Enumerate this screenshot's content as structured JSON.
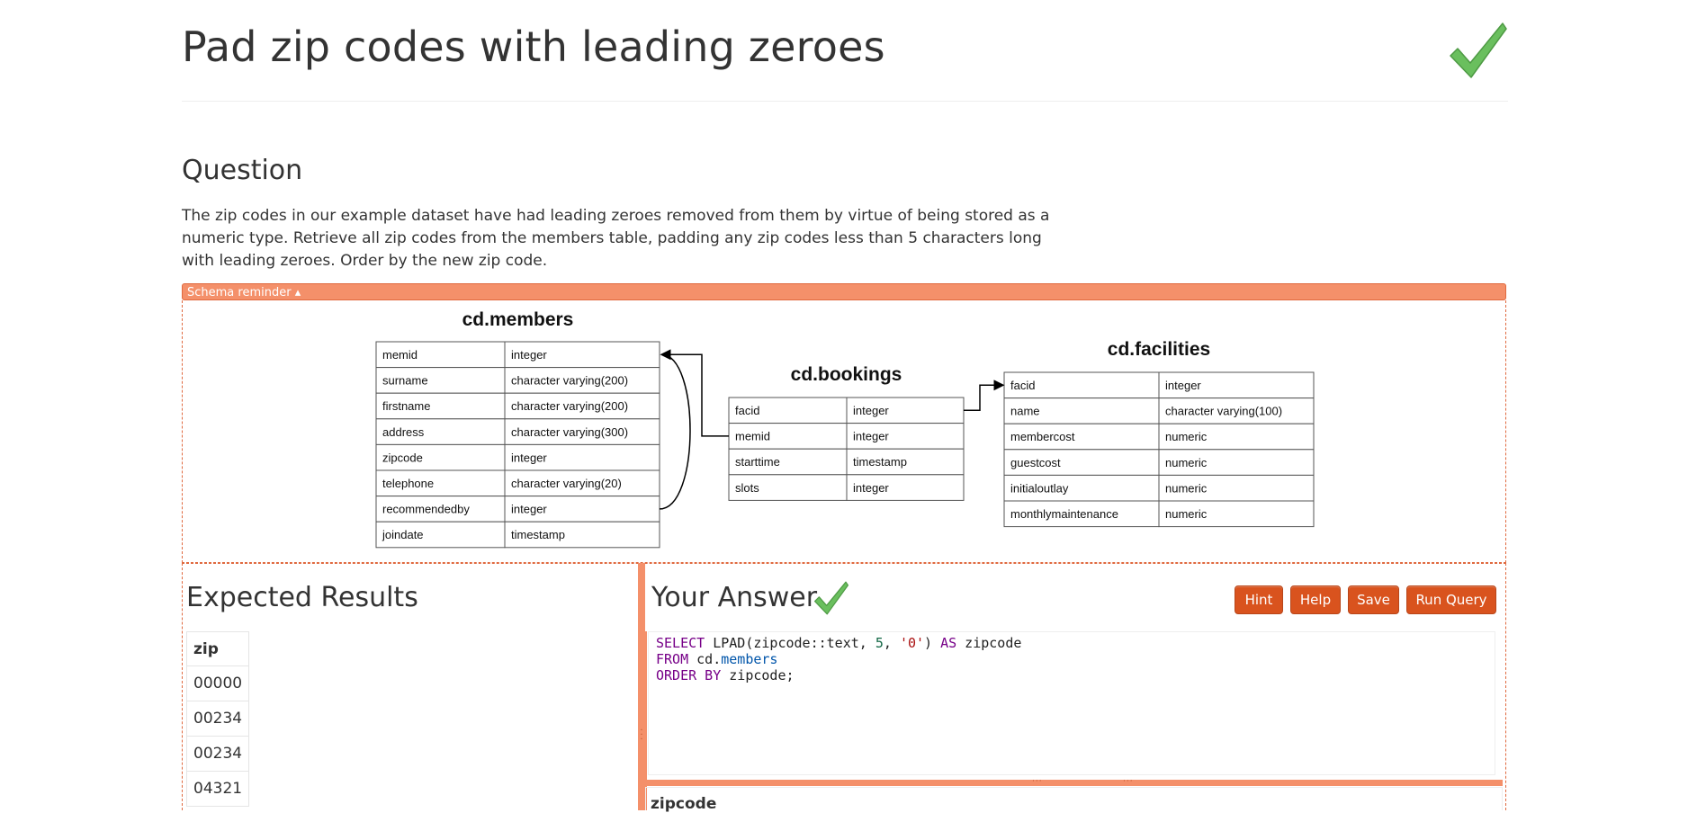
{
  "page": {
    "title": "Pad zip codes with leading zeroes"
  },
  "question": {
    "heading": "Question",
    "text": "The zip codes in our example dataset have had leading zeroes removed from them by virtue of being stored as a numeric type. Retrieve all zip codes from the members table, padding any zip codes less than 5 characters long with leading zeroes. Order by the new zip code."
  },
  "schema": {
    "toggle_label": "Schema reminder ▴",
    "tables": [
      {
        "name": "cd.members",
        "columns": [
          {
            "col": "memid",
            "type": "integer"
          },
          {
            "col": "surname",
            "type": "character varying(200)"
          },
          {
            "col": "firstname",
            "type": "character varying(200)"
          },
          {
            "col": "address",
            "type": "character varying(300)"
          },
          {
            "col": "zipcode",
            "type": "integer"
          },
          {
            "col": "telephone",
            "type": "character varying(20)"
          },
          {
            "col": "recommendedby",
            "type": "integer"
          },
          {
            "col": "joindate",
            "type": "timestamp"
          }
        ]
      },
      {
        "name": "cd.bookings",
        "columns": [
          {
            "col": "facid",
            "type": "integer"
          },
          {
            "col": "memid",
            "type": "integer"
          },
          {
            "col": "starttime",
            "type": "timestamp"
          },
          {
            "col": "slots",
            "type": "integer"
          }
        ]
      },
      {
        "name": "cd.facilities",
        "columns": [
          {
            "col": "facid",
            "type": "integer"
          },
          {
            "col": "name",
            "type": "character varying(100)"
          },
          {
            "col": "membercost",
            "type": "numeric"
          },
          {
            "col": "guestcost",
            "type": "numeric"
          },
          {
            "col": "initialoutlay",
            "type": "numeric"
          },
          {
            "col": "monthlymaintenance",
            "type": "numeric"
          }
        ]
      }
    ]
  },
  "expected": {
    "heading": "Expected Results",
    "column": "zip",
    "rows": [
      "00000",
      "00234",
      "00234",
      "04321"
    ]
  },
  "answer": {
    "heading": "Your Answer",
    "buttons": {
      "hint": "Hint",
      "help": "Help",
      "save": "Save",
      "run": "Run Query"
    },
    "code": {
      "l1_kw1": "SELECT",
      "l1_mid": " LPAD(zipcode::text, ",
      "l1_num": "5",
      "l1_comma": ", ",
      "l1_str": "'0'",
      "l1_paren": ") ",
      "l1_kw2": "AS",
      "l1_end": " zipcode",
      "l2_kw": "FROM",
      "l2_schema": " cd.",
      "l2_table": "members",
      "l3_kw": "ORDER BY",
      "l3_end": " zipcode;"
    },
    "result_column": "zipcode"
  },
  "colors": {
    "accent": "#f4906a",
    "button": "#d9531e",
    "check": "#6abf5e"
  },
  "icons": {
    "title_check": "check-mark-icon",
    "answer_check": "check-mark-icon"
  }
}
